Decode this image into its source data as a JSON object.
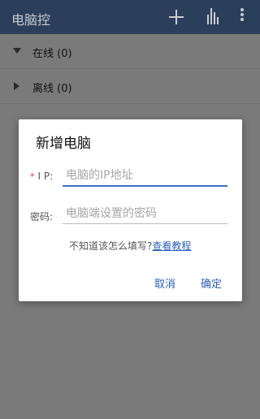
{
  "appbar": {
    "title": "电脑控",
    "icons": [
      "add-icon",
      "bar-chart-icon",
      "more-vert-icon"
    ]
  },
  "groups": [
    {
      "label": "在线 (0)",
      "expanded": true
    },
    {
      "label": "离线 (0)",
      "expanded": false
    }
  ],
  "dialog": {
    "title": "新增电脑",
    "required_mark": "*",
    "ip_label": "I P:",
    "ip_placeholder": "电脑的IP地址",
    "password_label": "密码:",
    "password_placeholder": "电脑端设置的密码",
    "hint_text": "不知道该怎么填写?",
    "hint_link": "查看教程",
    "cancel_label": "取消",
    "confirm_label": "确定"
  },
  "colors": {
    "appbar": "#2c3f5a",
    "accent": "#2a5fbf",
    "required": "#d32f2f"
  }
}
